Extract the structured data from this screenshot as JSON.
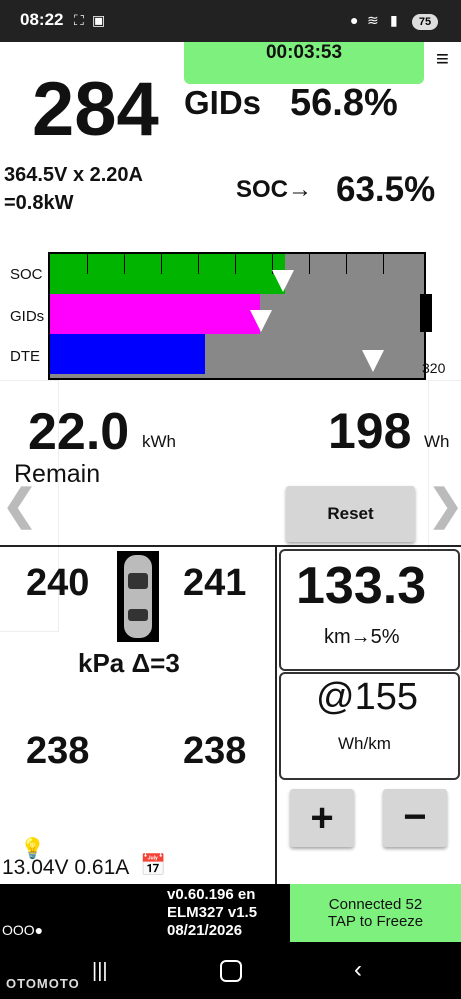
{
  "status_bar": {
    "time": "08:22",
    "battery": "75"
  },
  "timer": "00:03:53",
  "gids": {
    "value": "284",
    "label": "GIDs",
    "percent": "56.8%"
  },
  "power": {
    "line1": "364.5V x 2.20A",
    "line2": "=0.8kW"
  },
  "soc": {
    "label": "SOC→",
    "percent": "63.5%"
  },
  "bars": {
    "labels": [
      "SOC",
      "GIDs",
      "DTE"
    ],
    "max_label": "320",
    "soc_fill": 0.635,
    "gids_fill": 0.568,
    "dte_fill": 0.42,
    "colors": {
      "soc": "#00b400",
      "gids": "#ff00ff",
      "dte": "#0000ff"
    }
  },
  "energy": {
    "remain_value": "22.0",
    "remain_unit": "kWh",
    "remain_label": "Remain",
    "wh_value": "198",
    "wh_unit": "Wh",
    "reset_label": "Reset"
  },
  "tires": {
    "front_left": "240",
    "front_right": "241",
    "rear_left": "238",
    "rear_right": "238",
    "unit_delta": "kPa  Δ=3"
  },
  "range": {
    "value": "133.3",
    "label": "km→5%"
  },
  "efficiency": {
    "value": "@155",
    "label": "Wh/km"
  },
  "buttons": {
    "plus": "+",
    "minus": "−"
  },
  "aux": {
    "voltage": "13.04V 0.61A"
  },
  "version": {
    "line1": "v0.60.196 en",
    "line2": "ELM327 v1.5",
    "line3": "08/21/2026"
  },
  "connection": {
    "line1": "Connected 52",
    "line2": "TAP to Freeze"
  },
  "watermark": "OTOMOTO",
  "dots": "OOO●"
}
